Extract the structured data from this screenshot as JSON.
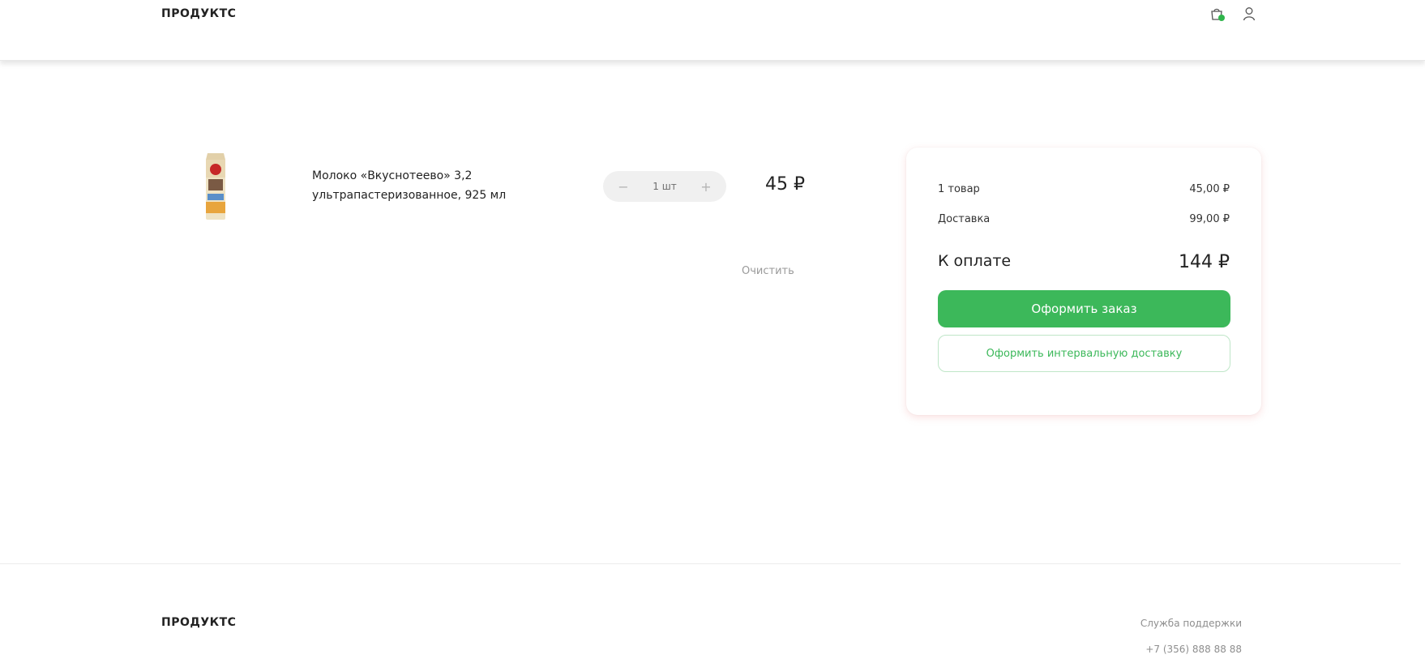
{
  "header": {
    "logo": "ПРОДУКТС"
  },
  "cart": {
    "items": [
      {
        "name": "Молоко «Вкуснотеево» 3,2 ультрапастеризованное, 925 мл",
        "quantity_label": "1 шт",
        "price": "45 ₽",
        "decrement_label": "−",
        "increment_label": "+"
      }
    ],
    "clear_label": "Очистить"
  },
  "summary": {
    "items_label": "1 товар",
    "items_value": "45,00 ₽",
    "delivery_label": "Доставка",
    "delivery_value": "99,00 ₽",
    "total_label": "К оплате",
    "total_value": "144 ₽",
    "checkout_label": "Оформить заказ",
    "interval_label": "Оформить интервальную доставку"
  },
  "footer": {
    "logo": "ПРОДУКТС",
    "support_label": "Служба поддержки",
    "support_phone": "+7 (356) 888 88 88"
  },
  "colors": {
    "accent": "#3cb85a",
    "badge": "#2fb54b"
  },
  "icons": {
    "cart": "shopping-bag-icon",
    "user": "user-icon"
  }
}
